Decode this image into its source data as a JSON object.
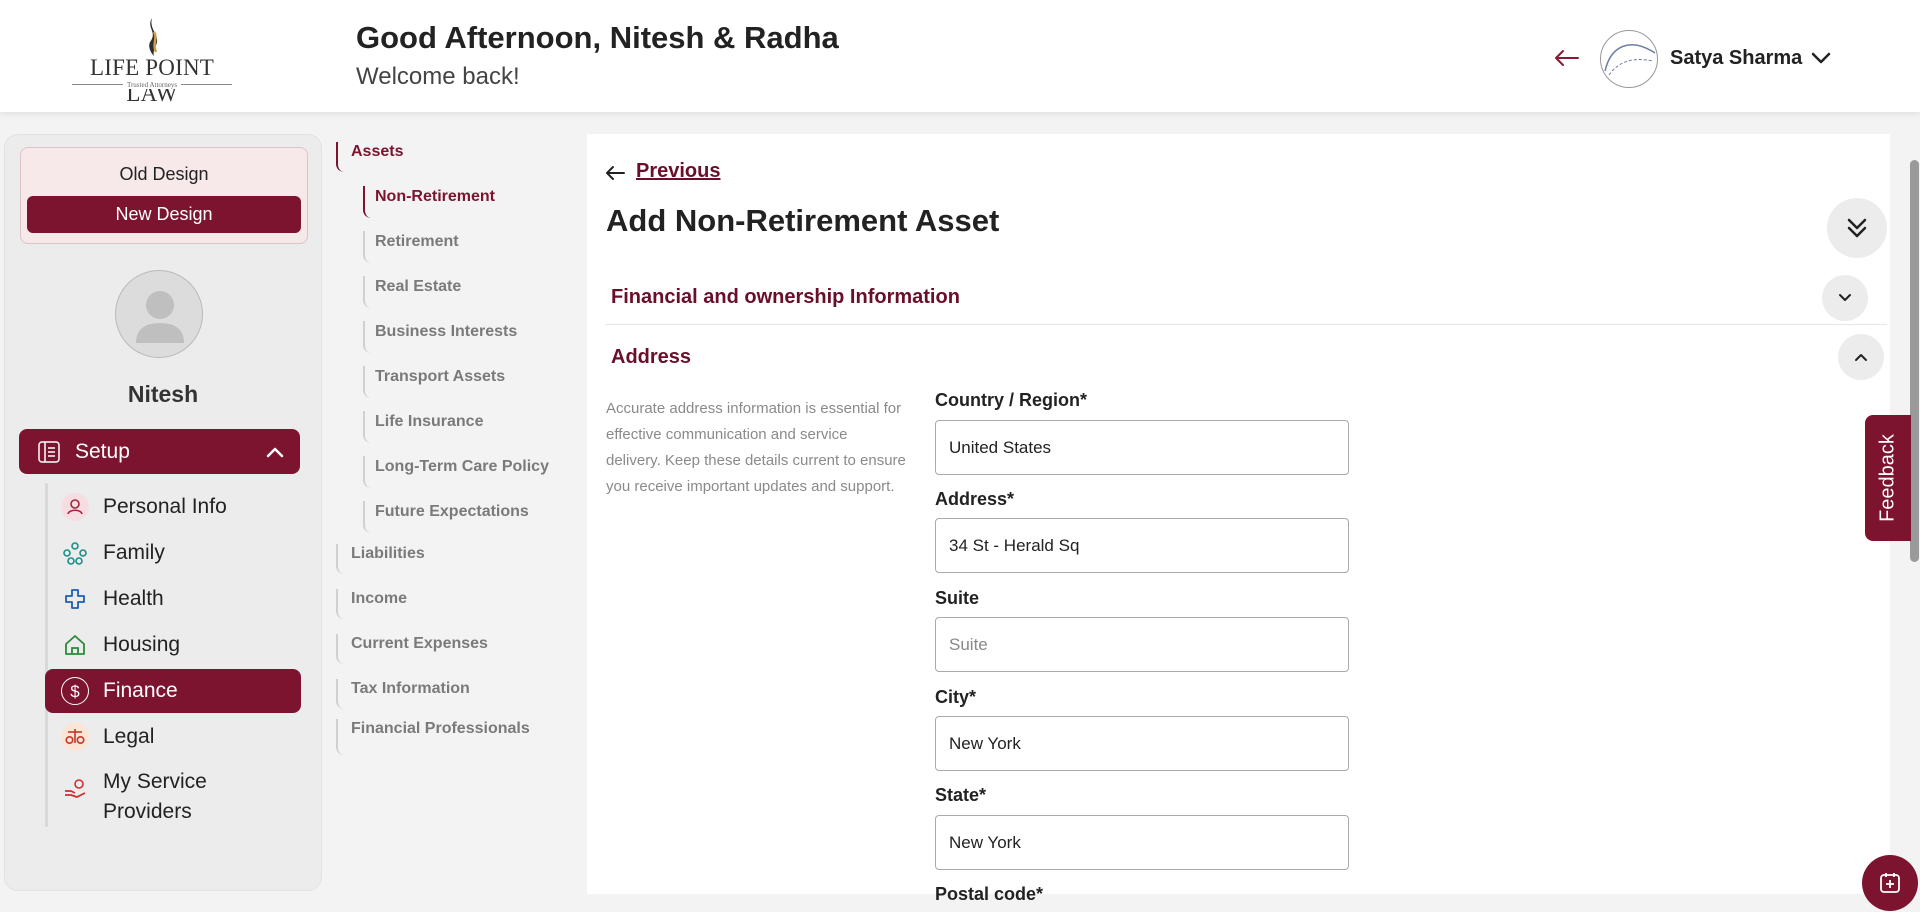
{
  "header": {
    "logo_text": "LIFE POINT LAW",
    "logo_tagline": "Trusted Attorneys",
    "greeting": "Good Afternoon, Nitesh & Radha",
    "welcome": "Welcome back!",
    "user_name": "Satya Sharma"
  },
  "sidebar": {
    "old_design_label": "Old Design",
    "new_design_label": "New Design",
    "profile_name": "Nitesh",
    "setup_label": "Setup",
    "items": [
      {
        "label": "Personal Info",
        "icon": "person-icon"
      },
      {
        "label": "Family",
        "icon": "family-tree-icon"
      },
      {
        "label": "Health",
        "icon": "health-cross-icon"
      },
      {
        "label": "Housing",
        "icon": "home-icon"
      },
      {
        "label": "Finance",
        "icon": "dollar-icon",
        "active": true
      },
      {
        "label": "Legal",
        "icon": "scales-icon"
      },
      {
        "label": "My Service Providers",
        "icon": "service-hand-icon"
      }
    ]
  },
  "subnav": {
    "groups": [
      {
        "label": "Assets",
        "active": true
      },
      {
        "label": "Liabilities"
      },
      {
        "label": "Income"
      },
      {
        "label": "Current Expenses"
      },
      {
        "label": "Tax Information"
      },
      {
        "label": "Financial Professionals"
      }
    ],
    "asset_items": [
      {
        "label": "Non-Retirement",
        "active": true
      },
      {
        "label": "Retirement"
      },
      {
        "label": "Real Estate"
      },
      {
        "label": "Business Interests"
      },
      {
        "label": "Transport Assets"
      },
      {
        "label": "Life Insurance"
      },
      {
        "label": "Long-Term Care Policy"
      },
      {
        "label": "Future Expectations"
      }
    ]
  },
  "main": {
    "previous_label": "Previous",
    "title": "Add Non-Retirement Asset",
    "section_financial": "Financial and ownership Information",
    "section_address": "Address",
    "address_description": "Accurate address information is essential for effective communication and service delivery. Keep these details current to ensure you receive important updates and support.",
    "fields": {
      "country": {
        "label": "Country / Region*",
        "value": "United States"
      },
      "address": {
        "label": "Address*",
        "value": "34 St - Herald Sq"
      },
      "suite": {
        "label": "Suite",
        "value": "",
        "placeholder": "Suite"
      },
      "city": {
        "label": "City*",
        "value": "New York"
      },
      "state": {
        "label": "State*",
        "value": "New York"
      },
      "postal": {
        "label": "Postal code*"
      }
    }
  },
  "feedback_label": "Feedback",
  "colors": {
    "brand": "#7c1430",
    "brand_text": "#6a0f2a",
    "muted": "#7a7a7a"
  }
}
